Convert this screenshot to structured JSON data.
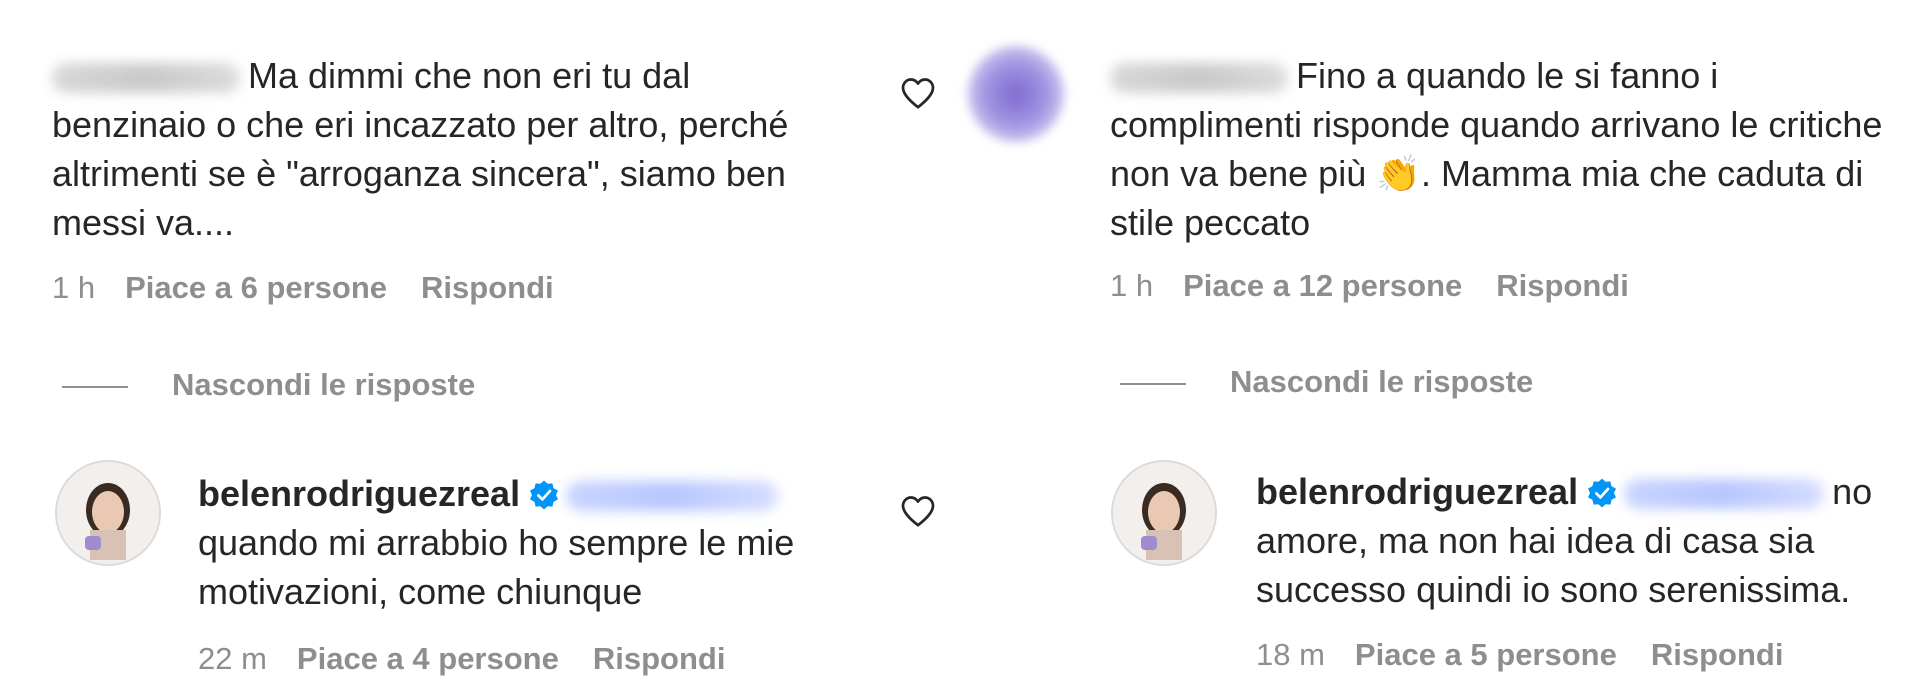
{
  "left": {
    "parent": {
      "text": "Ma dimmi che non eri tu dal benzinaio o che eri incazzato per altro, perché altrimenti se è \"arroganza sincera\", siamo ben messi va....",
      "time": "1 h",
      "likes": "Piace a 6 persone",
      "reply_label": "Rispondi"
    },
    "hide_replies": "Nascondi le risposte",
    "reply": {
      "username": "belenrodriguezreal",
      "text": "quando mi arrabbio ho sempre le mie motivazioni, come chiunque",
      "time": "22 m",
      "likes": "Piace a 4 persone",
      "reply_label": "Rispondi"
    }
  },
  "right": {
    "parent": {
      "text": "Fino a quando le si fanno i complimenti risponde quando arrivano le critiche non va bene più 👏. Mamma mia che caduta di stile peccato",
      "time": "1 h",
      "likes": "Piace a 12 persone",
      "reply_label": "Rispondi"
    },
    "hide_replies": "Nascondi le risposte",
    "reply": {
      "username": "belenrodriguezreal",
      "text_line1_tail": "no",
      "text_rest": "amore, ma non hai idea di casa sia successo quindi io sono serenissima.",
      "time": "18 m",
      "likes": "Piace a 5 persone",
      "reply_label": "Rispondi"
    }
  },
  "icons": {
    "like": "heart-outline-icon",
    "verified": "verified-badge-icon"
  },
  "colors": {
    "text": "#262626",
    "meta": "#8e8e8e",
    "verified": "#0095f6"
  }
}
